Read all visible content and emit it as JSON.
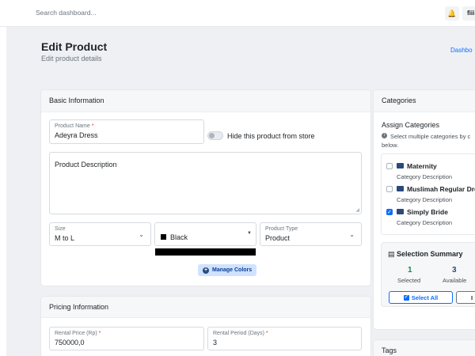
{
  "topbar": {
    "search_placeholder": "Search dashboard...",
    "user_label": "fiii"
  },
  "page": {
    "title": "Edit Product",
    "subtitle": "Edit product details",
    "breadcrumb": "Dashbo"
  },
  "basic": {
    "header": "Basic Information",
    "product_name_label": "Product Name",
    "product_name_value": "Adeyra Dress",
    "hide_label": "Hide this product from store",
    "description_placeholder": "Product Description",
    "size_label": "Size",
    "size_value": "M to L",
    "color_value": "Black",
    "type_label": "Product Type",
    "type_value": "Product",
    "manage_colors": "Manage Colors"
  },
  "pricing": {
    "header": "Pricing Information",
    "price_label": "Rental Price (Rp)",
    "price_value": "750000,0",
    "period_label": "Rental Period (Days)",
    "period_value": "3"
  },
  "categories": {
    "header": "Categories",
    "assign_title": "Assign Categories",
    "help_line1": "Select multiple categories by c",
    "help_line2": "below.",
    "items": [
      {
        "name": "Maternity",
        "desc": "Category Description",
        "checked": false
      },
      {
        "name": "Muslimah Regular Dre",
        "desc": "Category Description",
        "checked": false
      },
      {
        "name": "Simply Bride",
        "desc": "Category Description",
        "checked": true
      }
    ],
    "summary_title": "Selection Summary",
    "selected_count": "1",
    "selected_label": "Selected",
    "available_count": "3",
    "available_label": "Available",
    "select_all": "Select All",
    "second_btn": "I"
  },
  "tags": {
    "header": "Tags"
  },
  "colors": {
    "accent": "#0d6efd",
    "success": "#198754"
  }
}
